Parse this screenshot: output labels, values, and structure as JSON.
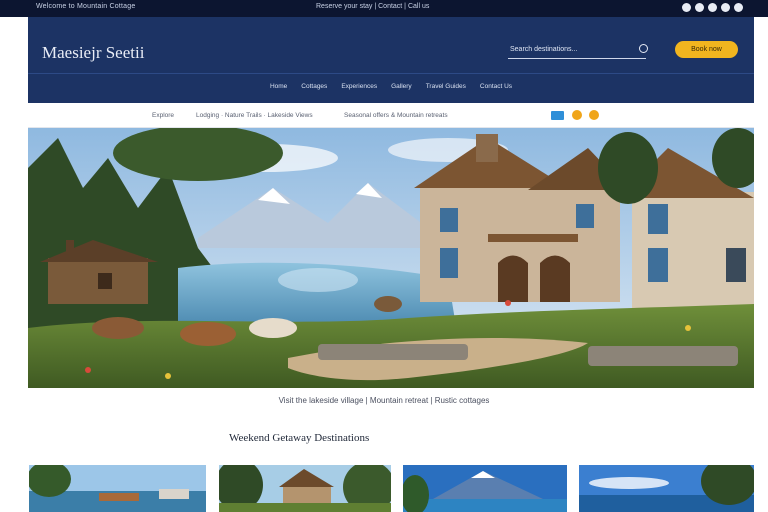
{
  "topbar": {
    "left_text": "Welcome to Mountain Cottage",
    "right_text": "Reserve your stay | Contact | Call us",
    "social_icons": [
      "facebook-icon",
      "twitter-icon",
      "instagram-icon",
      "pinterest-icon",
      "youtube-icon"
    ]
  },
  "header": {
    "logo_text": "Maesiejr Seetii",
    "search_placeholder": "Search destinations...",
    "cta_label": "Book now",
    "nav": [
      "Home",
      "Cottages",
      "Experiences",
      "Gallery",
      "Travel Guides",
      "Contact Us"
    ]
  },
  "subnav": {
    "item1": "Explore",
    "item2": "Lodging · Nature Trails · Lakeside Views",
    "item3": "Seasonal offers & Mountain retreats"
  },
  "hero": {
    "caption": "Visit the lakeside village | Mountain retreat | Rustic cottages"
  },
  "section": {
    "title": "Weekend Getaway Destinations"
  },
  "colors": {
    "header_bg": "#1c3364",
    "topbar_bg": "#0c1530",
    "accent": "#f1b51f",
    "link_blue": "#2f8fd8"
  }
}
